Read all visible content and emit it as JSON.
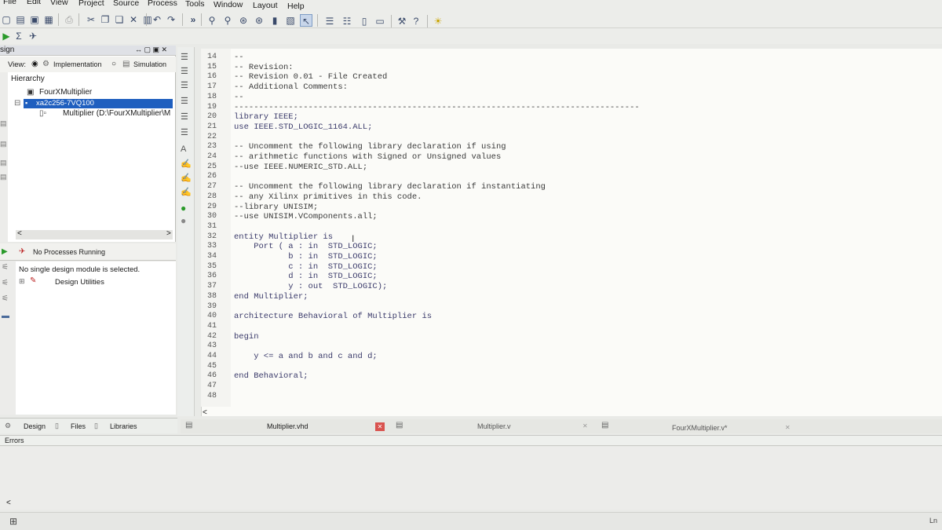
{
  "menu": [
    "File",
    "Edit",
    "View",
    "Project",
    "Source",
    "Process",
    "Tools",
    "Window",
    "Layout",
    "Help"
  ],
  "toolbar": {
    "overflow_label": "»"
  },
  "design_panel": {
    "title": "sign",
    "panel_controls": "↔ ▢ ▣ ✕",
    "view_label": "View:",
    "implementation_label": "Implementation",
    "simulation_label": "Simulation",
    "hierarchy_label": "Hierarchy",
    "items": [
      {
        "label": "FourXMultiplier"
      },
      {
        "label": "xa2c256-7VQ100"
      },
      {
        "label": "Multiplier (D:\\FourXMultiplier\\M"
      }
    ],
    "scroll_left": "<",
    "scroll_right": ">"
  },
  "processes": {
    "status": "No Processes Running",
    "message": "No single design module is selected.",
    "item": "Design Utilities"
  },
  "editor": {
    "lines": [
      {
        "n": "14",
        "t": "--",
        "c": "cmt"
      },
      {
        "n": "15",
        "t": "-- Revision:",
        "c": "cmt"
      },
      {
        "n": "16",
        "t": "-- Revision 0.01 - File Created",
        "c": "cmt"
      },
      {
        "n": "17",
        "t": "-- Additional Comments:",
        "c": "cmt"
      },
      {
        "n": "18",
        "t": "--",
        "c": "cmt"
      },
      {
        "n": "19",
        "t": "----------------------------------------------------------------------------------",
        "c": "cmt"
      },
      {
        "n": "20",
        "t": "library IEEE;",
        "c": "kw"
      },
      {
        "n": "21",
        "t": "use IEEE.STD_LOGIC_1164.ALL;",
        "c": "kw"
      },
      {
        "n": "22",
        "t": "",
        "c": "kw"
      },
      {
        "n": "23",
        "t": "-- Uncomment the following library declaration if using",
        "c": "cmt"
      },
      {
        "n": "24",
        "t": "-- arithmetic functions with Signed or Unsigned values",
        "c": "cmt"
      },
      {
        "n": "25",
        "t": "--use IEEE.NUMERIC_STD.ALL;",
        "c": "cmt"
      },
      {
        "n": "26",
        "t": "",
        "c": "cmt"
      },
      {
        "n": "27",
        "t": "-- Uncomment the following library declaration if instantiating",
        "c": "cmt"
      },
      {
        "n": "28",
        "t": "-- any Xilinx primitives in this code.",
        "c": "cmt"
      },
      {
        "n": "29",
        "t": "--library UNISIM;",
        "c": "cmt"
      },
      {
        "n": "30",
        "t": "--use UNISIM.VComponents.all;",
        "c": "cmt"
      },
      {
        "n": "31",
        "t": "",
        "c": "kw"
      },
      {
        "n": "32",
        "t": "entity Multiplier is",
        "c": "kw"
      },
      {
        "n": "33",
        "t": "    Port ( a : in  STD_LOGIC;",
        "c": "kw"
      },
      {
        "n": "34",
        "t": "           b : in  STD_LOGIC;",
        "c": "kw"
      },
      {
        "n": "35",
        "t": "           c : in  STD_LOGIC;",
        "c": "kw"
      },
      {
        "n": "36",
        "t": "           d : in  STD_LOGIC;",
        "c": "kw"
      },
      {
        "n": "37",
        "t": "           y : out  STD_LOGIC);",
        "c": "kw"
      },
      {
        "n": "38",
        "t": "end Multiplier;",
        "c": "kw"
      },
      {
        "n": "39",
        "t": "",
        "c": "kw"
      },
      {
        "n": "40",
        "t": "architecture Behavioral of Multiplier is",
        "c": "kw"
      },
      {
        "n": "41",
        "t": "",
        "c": "kw"
      },
      {
        "n": "42",
        "t": "begin",
        "c": "kw"
      },
      {
        "n": "43",
        "t": "",
        "c": "kw"
      },
      {
        "n": "44",
        "t": "    y <= a and b and c and d;",
        "c": "kw"
      },
      {
        "n": "45",
        "t": "",
        "c": "kw"
      },
      {
        "n": "46",
        "t": "end Behavioral;",
        "c": "kw"
      },
      {
        "n": "47",
        "t": "",
        "c": "kw"
      },
      {
        "n": "48",
        "t": "",
        "c": "kw"
      }
    ],
    "scroll_left": "<"
  },
  "left_tabs": [
    "Design",
    "Files",
    "Libraries"
  ],
  "editor_tabs": [
    {
      "label": "Multiplier.vhd"
    },
    {
      "label": "Multiplier.v"
    },
    {
      "label": "FourXMultiplier.v*"
    }
  ],
  "errors": {
    "label": "Errors",
    "scroll_left": "<"
  },
  "status": {
    "ln": "Ln"
  },
  "colors": {
    "selection": "#1f5fbf",
    "close_tab": "#d9534f",
    "code_text": "#3b3b8a"
  }
}
